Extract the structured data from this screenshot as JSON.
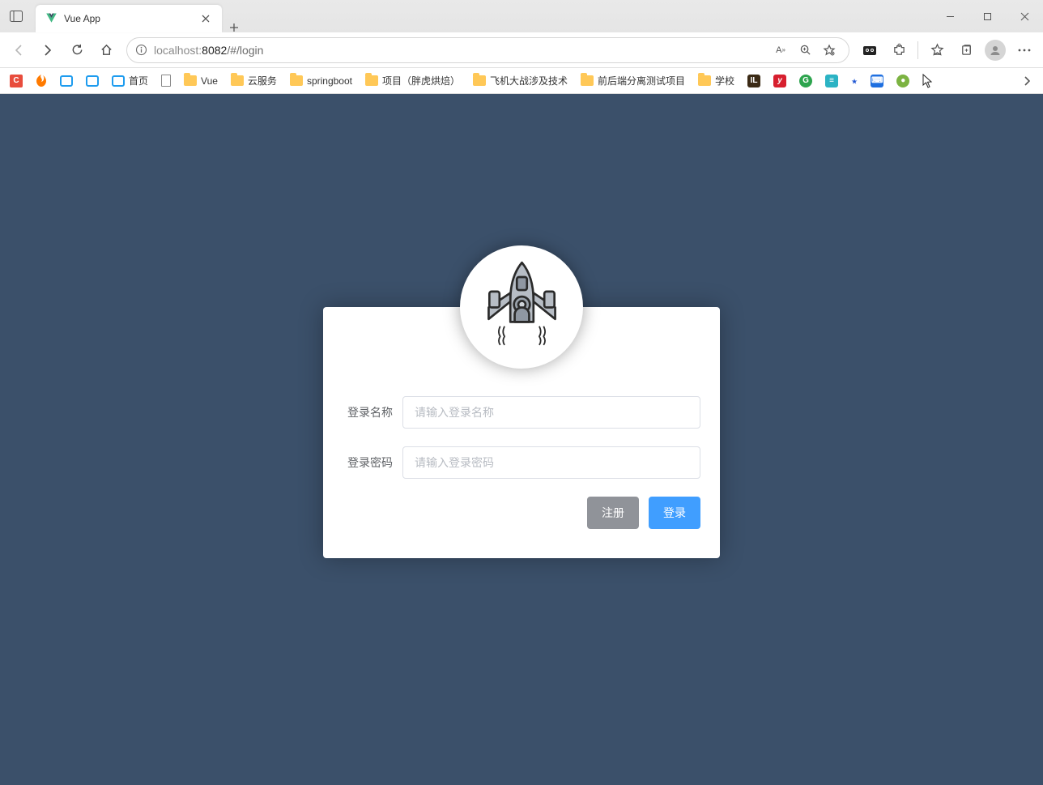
{
  "tab": {
    "title": "Vue App"
  },
  "url": {
    "host_dim": "localhost:",
    "host_port": "8082",
    "path": "/#/login"
  },
  "bookmarks": {
    "home_label": "首页",
    "items": [
      {
        "label": "Vue"
      },
      {
        "label": "云服务"
      },
      {
        "label": "springboot"
      },
      {
        "label": "项目（胖虎烘焙）"
      },
      {
        "label": "飞机大战涉及技术"
      },
      {
        "label": "前后端分离测试项目"
      },
      {
        "label": "学校"
      }
    ]
  },
  "extras": {
    "read_aloud": "A⁺⁾",
    "lol": "IL",
    "y": "y",
    "g": "G",
    "tb": "≡",
    "paw": "٭",
    "kb": "⌨",
    "dot": "●"
  },
  "login": {
    "username_label": "登录名称",
    "username_placeholder": "请输入登录名称",
    "password_label": "登录密码",
    "password_placeholder": "请输入登录密码",
    "register_btn": "注册",
    "login_btn": "登录"
  }
}
